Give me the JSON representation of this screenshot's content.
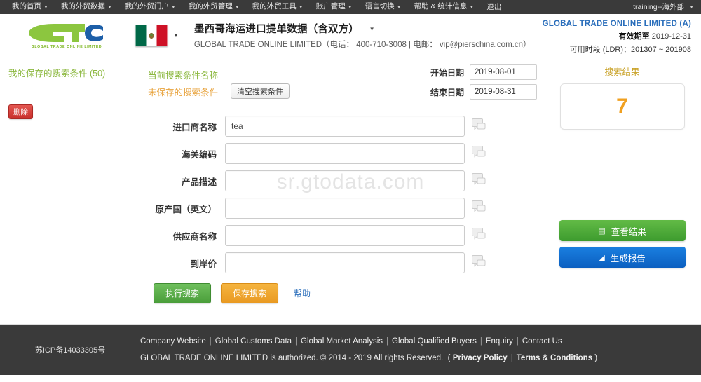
{
  "topnav": {
    "items": [
      {
        "label": "我的首页",
        "caret": true
      },
      {
        "label": "我的外贸数据",
        "caret": true
      },
      {
        "label": "我的外贸门户",
        "caret": true
      },
      {
        "label": "我的外贸管理",
        "caret": true
      },
      {
        "label": "我的外贸工具",
        "caret": true
      },
      {
        "label": "账户管理",
        "caret": true
      },
      {
        "label": "语言切换",
        "caret": true
      },
      {
        "label": "帮助 & 统计信息",
        "caret": true
      },
      {
        "label": "退出",
        "caret": false
      }
    ],
    "user": "training--海外部"
  },
  "header": {
    "logo_text": "GTO",
    "logo_tagline": "GLOBAL TRADE ONLINE LIMITED",
    "flag_country": "mexico-flag",
    "title": "墨西哥海运进口提单数据（含双方）",
    "subtitle": "GLOBAL TRADE ONLINE LIMITED（电话： 400-710-3008 | 电邮： vip@pierschina.com.cn）",
    "account_name": "GLOBAL TRADE ONLINE LIMITED (A)",
    "valid_label": "有效期至",
    "valid_value": "2019-12-31",
    "ldr_line": "可用时段 (LDR)：201307 ~ 201908"
  },
  "sidebar": {
    "saved_title": "我的保存的搜索条件 (50)",
    "delete_button": "删除"
  },
  "search": {
    "current_name_label": "当前搜索条件名称",
    "unsaved_label": "未保存的搜索条件",
    "clear_button": "清空搜索条件",
    "start_date_label": "开始日期",
    "start_date_value": "2019-08-01",
    "end_date_label": "结束日期",
    "end_date_value": "2019-08-31",
    "fields": [
      {
        "label": "进口商名称",
        "value": "tea",
        "placeholder": ""
      },
      {
        "label": "海关编码",
        "value": "",
        "placeholder": ""
      },
      {
        "label": "产品描述",
        "value": "",
        "placeholder": ""
      },
      {
        "label": "原产国（英文）",
        "value": "",
        "placeholder": ""
      },
      {
        "label": "供应商名称",
        "value": "",
        "placeholder": ""
      },
      {
        "label": "到岸价",
        "value": "",
        "placeholder": ""
      }
    ],
    "exec_button": "执行搜索",
    "save_button": "保存搜索",
    "help_link": "帮助"
  },
  "results": {
    "title": "搜索结果",
    "count": "7",
    "view_button": "查看结果",
    "report_button": "生成报告"
  },
  "watermark": "sr.gtodata.com",
  "footer": {
    "icp": "苏ICP备14033305号",
    "links": [
      "Company Website",
      "Global Customs Data",
      "Global Market Analysis",
      "Global Qualified Buyers",
      "Enquiry",
      "Contact Us"
    ],
    "copyright": "GLOBAL TRADE ONLINE LIMITED is authorized. © 2014 - 2019 All rights Reserved.",
    "privacy": "Privacy Policy",
    "terms": "Terms & Conditions"
  },
  "colors": {
    "nav_bg": "#3a3a3a",
    "accent_green": "#8cb83f",
    "accent_orange": "#f0a020",
    "link_blue": "#2a6ebb",
    "button_green": "#4a9e3a",
    "button_blue": "#0b5fc0",
    "danger_red": "#c9302c"
  }
}
